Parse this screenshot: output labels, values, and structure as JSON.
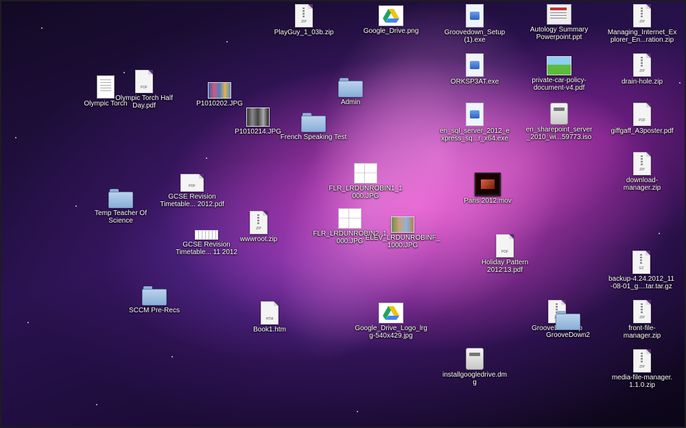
{
  "desktop": {
    "icons": [
      {
        "label": "PlayGuy_1_03b.zip",
        "type": "zip"
      },
      {
        "label": "Google_Drive.png",
        "type": "gdrive"
      },
      {
        "label": "Groovedown_Setup\n(1).exe",
        "type": "exe"
      },
      {
        "label": "Autology Summary\nPowerpoint.ppt",
        "type": "ppt"
      },
      {
        "label": "Managing_Internet_Ex\nplorer_En...ration.zip",
        "type": "zip"
      },
      {
        "label": "Olympic Torch",
        "type": "scan"
      },
      {
        "label": "Olympic Torch Half\nDay.pdf",
        "type": "pdf"
      },
      {
        "label": "P1010202.JPG",
        "type": "photo-group"
      },
      {
        "label": "Admin",
        "type": "folder"
      },
      {
        "label": "ORKSP3AT.exe",
        "type": "exe"
      },
      {
        "label": "private-car-policy-\ndocument-v4.pdf",
        "type": "photo-green"
      },
      {
        "label": "drain-hole.zip",
        "type": "zip"
      },
      {
        "label": "P1010214.JPG",
        "type": "photo-street"
      },
      {
        "label": "French Speaking Test",
        "type": "folder"
      },
      {
        "label": "en_sql_server_2012_e\nxpress_sq...r_x64.exe",
        "type": "exe"
      },
      {
        "label": "en_sharepoint_server\n_2010_wi...59773.iso",
        "type": "dmg"
      },
      {
        "label": "giffgaff_A3poster.pdf",
        "type": "pdf"
      },
      {
        "label": "GCSE Revision\nTimetable... 2012.pdf",
        "type": "pdf"
      },
      {
        "label": "FLR_LRDUNROBIN1_1\n000.JPG",
        "type": "blueprint"
      },
      {
        "label": "download-\nmanager.zip",
        "type": "zip"
      },
      {
        "label": "Temp Teacher Of\nScience",
        "type": "folder"
      },
      {
        "label": "Paris 2012.mov",
        "type": "movie"
      },
      {
        "label": "wwwroot.zip",
        "type": "zip"
      },
      {
        "label": "FLR_LRDUNROBIN2_1\n000.JPG",
        "type": "blueprint"
      },
      {
        "label": "ELEV_LRDUNROBINF_\n1000.JPG",
        "type": "photo-group"
      },
      {
        "label": "GCSE Revision\nTimetable... 11 2012",
        "type": "strip"
      },
      {
        "label": "Holiday Pattern\n2012'13.pdf",
        "type": "pdf"
      },
      {
        "label": "backup-4.24.2012_11\n-08-01_g....tar.tar.gz",
        "type": "gz"
      },
      {
        "label": "SCCM Pre-Recs",
        "type": "folder"
      },
      {
        "label": "Book1.htm",
        "type": "htm"
      },
      {
        "label": "Google_Drive_Logo_lrg\ng-540x429.jpg",
        "type": "gdrive"
      },
      {
        "label": "GrooveDown.zip",
        "type": "zip"
      },
      {
        "label": "GrooveDown2",
        "type": "folder"
      },
      {
        "label": "front-file-\nmanager.zip",
        "type": "zip"
      },
      {
        "label": "installgoogledrive.dm\ng",
        "type": "dmg"
      },
      {
        "label": "media-file-manager.\n1.1.0.zip",
        "type": "zip"
      }
    ]
  },
  "icon_tags": {
    "zip": "ZIP",
    "pdf": "PDF",
    "htm": "HTM",
    "gz": "GZ"
  },
  "colors": {
    "accent_magenta": "#ec4acc",
    "folder_blue": "#8aaed7"
  }
}
